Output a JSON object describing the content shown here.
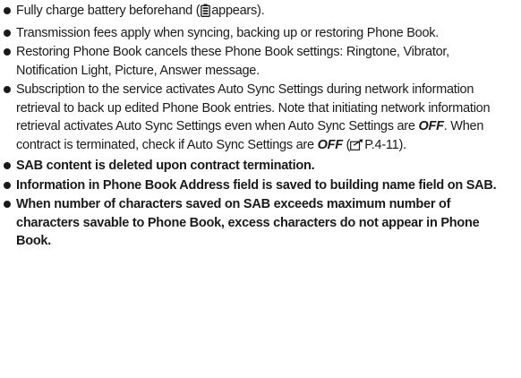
{
  "notes": {
    "item1": {
      "before": "Fully charge battery beforehand (",
      "icon": "battery-icon",
      "after": "appears)."
    },
    "item2": "Transmission fees apply when syncing, backing up or restoring Phone Book.",
    "item3": "Restoring Phone Book cancels these Phone Book settings: Ringtone, Vibrator, Notification Light, Picture, Answer message.",
    "item4": {
      "part1": "Subscription to the service activates Auto Sync Settings during network information retrieval to back up edited Phone Book entries. Note that initiating network information retrieval activates Auto Sync Settings even when Auto Sync Settings are ",
      "off1": "OFF",
      "part2": ". When contract is terminated, check if Auto Sync Settings are ",
      "off2": "OFF",
      "part3": " (",
      "ref_icon": "reference-pointer-icon",
      "ref": "P.4-11",
      "part4": ")."
    },
    "item5": "SAB content is deleted upon contract termination.",
    "item6": "Information in Phone Book Address field is saved to building name field on SAB.",
    "item7": "When number of characters saved on SAB exceeds maximum number of characters savable to Phone Book, excess characters do not appear in Phone Book."
  }
}
